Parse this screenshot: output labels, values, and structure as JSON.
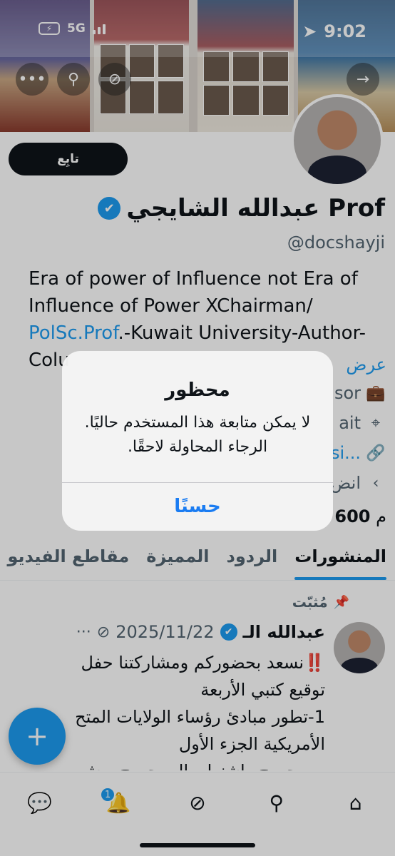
{
  "status_bar": {
    "network": "5G",
    "time": "9:02"
  },
  "profile": {
    "follow_label": "تابِع",
    "display_name": "عبدالله الشايجي Prof",
    "handle": "@docshayji",
    "bio_line1": "Era of power of Influence not Era of",
    "bio_line2": "Influence of Power XChairman/",
    "bio_link": "PolSc.Prof",
    "bio_line3_rest": ".-Kuwait University-Author-",
    "bio_line4": "Colu",
    "bio_more": "عرض",
    "meta_job": "sor",
    "meta_location": "ait",
    "meta_link": "si...",
    "meta_joined": "انض",
    "following_count": "600",
    "following_suffix": "م"
  },
  "tabs": [
    {
      "label": "المنشورات",
      "active": true
    },
    {
      "label": "الردود"
    },
    {
      "label": "المميزة"
    },
    {
      "label": "مقاطع الفيديو"
    }
  ],
  "post": {
    "pinned_label": "مُثبّت",
    "author": "عبدالله الـ",
    "date": "2025/11/22",
    "line1": "‼️نسعد بحضوركم ومشاركتنا حفل",
    "line2": "توقيع كتبي الأربعة",
    "line3": "1-تطور مبادئ رؤساء الولايات المتح",
    "line4": "الأمريكية الجزء الأول",
    "line5": "من جورج واشنطن إلى جورج بوش"
  },
  "nav": {
    "notifications_badge": "1"
  },
  "alert": {
    "title": "محظور",
    "message": "لا يمكن متابعة هذا المستخدم حاليًا. الرجاء المحاولة لاحقًا.",
    "button": "حسنًا"
  },
  "colors": {
    "accent": "#1d9bf0",
    "text": "#0f1419",
    "muted": "#536471",
    "alert_button": "#1a7cf2"
  },
  "icons": [
    "back-arrow-icon",
    "more-icon",
    "search-icon",
    "no-grok-icon",
    "forward-arrow-icon",
    "verified-icon",
    "briefcase-icon",
    "location-icon",
    "link-icon",
    "calendar-icon",
    "pin-icon",
    "compose-plus-icon",
    "chat-icon",
    "bell-icon",
    "grok-icon",
    "search-nav-icon",
    "home-icon"
  ]
}
